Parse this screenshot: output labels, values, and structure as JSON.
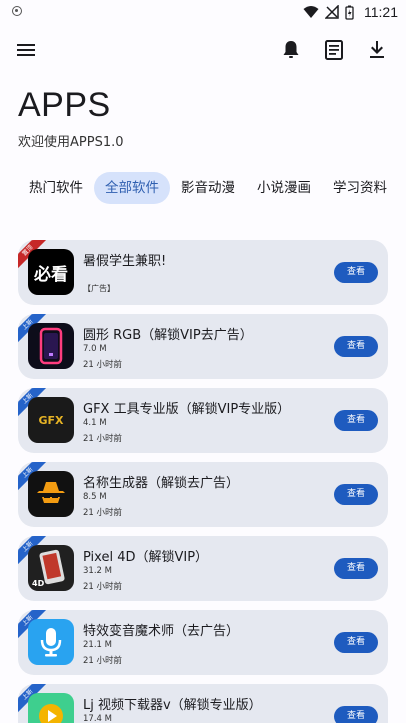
{
  "status_bar": {
    "time": "11:21"
  },
  "app": {
    "title": "APPS",
    "subtitle": "欢迎使用APPS1.0"
  },
  "tabs": [
    {
      "label": "热门软件",
      "active": false
    },
    {
      "label": "全部软件",
      "active": true
    },
    {
      "label": "影音动漫",
      "active": false
    },
    {
      "label": "小说漫画",
      "active": false
    },
    {
      "label": "学习资料",
      "active": false
    }
  ],
  "items": [
    {
      "ribbon": "置顶",
      "name": "暑假学生兼职!",
      "ad": "【广告】",
      "thumb_text": "必看",
      "button": "查看"
    },
    {
      "ribbon": "上新",
      "name": "圆形 RGB（解锁VIP去广告）",
      "size": "7.0 M",
      "time": "21 小时前",
      "button": "查看"
    },
    {
      "ribbon": "上新",
      "name": "GFX 工具专业版（解锁VIP专业版）",
      "size": "4.1 M",
      "time": "21 小时前",
      "thumb_text": "GFX",
      "button": "查看"
    },
    {
      "ribbon": "上新",
      "name": "名称生成器（解锁去广告）",
      "size": "8.5 M",
      "time": "21 小时前",
      "button": "查看"
    },
    {
      "ribbon": "上新",
      "name": "Pixel 4D（解锁VIP）",
      "size": "31.2 M",
      "time": "21 小时前",
      "thumb_text": "4D",
      "button": "查看"
    },
    {
      "ribbon": "上新",
      "name": "特效变音魔术师（去广告）",
      "size": "21.1 M",
      "time": "21 小时前",
      "button": "查看"
    },
    {
      "ribbon": "上新",
      "name": "Lj 视频下载器v（解锁专业版）",
      "size": "17.4 M",
      "button": "查看"
    }
  ],
  "colors": {
    "accent": "#1e5bbf",
    "tab_active_bg": "#d6e2fb",
    "card_bg": "#e5e8f0",
    "ribbon_new": "#2563c9",
    "ribbon_top": "#c62828"
  }
}
